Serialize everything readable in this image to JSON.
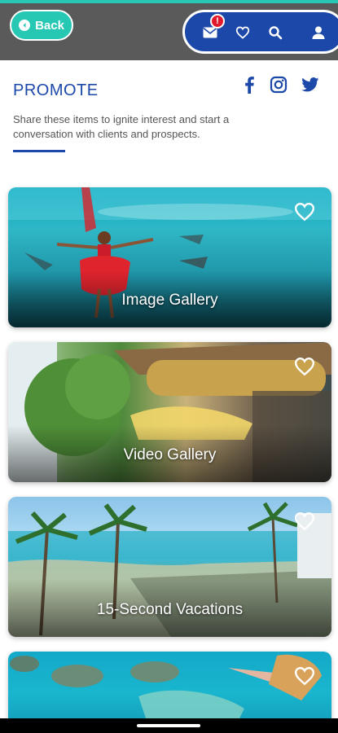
{
  "header": {
    "back_label": "Back",
    "notification_count": "!"
  },
  "promote": {
    "title": "PROMOTE",
    "description": "Share these items to ignite interest and start a conversation with clients and prospects."
  },
  "cards": [
    {
      "label": "Image Gallery"
    },
    {
      "label": "Video Gallery"
    },
    {
      "label": "15-Second Vacations"
    },
    {
      "label": ""
    }
  ],
  "colors": {
    "brand_blue": "#1c48a9",
    "teal": "#26c7b3",
    "header_gray": "#5a5a5a",
    "badge_red": "#e2192d"
  },
  "icons": {
    "back": "chevron-left-icon",
    "mail": "mail-icon",
    "favorites": "heart-icon",
    "search": "search-icon",
    "profile": "user-icon",
    "facebook": "facebook-icon",
    "instagram": "instagram-icon",
    "twitter": "twitter-icon",
    "card_favorite": "heart-outline-icon"
  }
}
